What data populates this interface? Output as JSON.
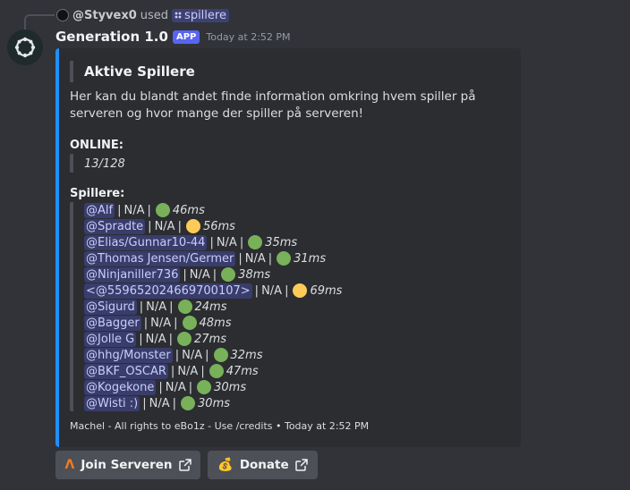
{
  "reply": {
    "user": "@Styvex0",
    "used_text": "used",
    "command": "spillere"
  },
  "message": {
    "bot_name": "Generation 1.0",
    "badge": "APP",
    "timestamp": "Today at 2:52 PM"
  },
  "embed": {
    "accent_color": "#1e90ff",
    "title": "Aktive Spillere",
    "description": "Her kan du blandt andet finde information omkring hvem spiller på serveren og hvor mange der spiller på serveren!",
    "online_label": "ONLINE:",
    "online_value": "13/128",
    "players_label": "Spillere:",
    "players": [
      {
        "name": "@Alf",
        "info": "N/A",
        "status": "green",
        "ping": "46ms"
      },
      {
        "name": "@Spradte",
        "info": "N/A",
        "status": "yellow",
        "ping": "56ms"
      },
      {
        "name": "@Elias/Gunnar10-44",
        "info": "N/A",
        "status": "green",
        "ping": "35ms"
      },
      {
        "name": "@Thomas Jensen/Germer",
        "info": "N/A",
        "status": "green",
        "ping": "31ms"
      },
      {
        "name": "@Ninjaniller736",
        "info": "N/A",
        "status": "green",
        "ping": "38ms"
      },
      {
        "name": "<@559652024669700107>",
        "info": "N/A",
        "status": "yellow",
        "ping": "69ms"
      },
      {
        "name": "@Sigurd",
        "info": "N/A",
        "status": "green",
        "ping": "24ms"
      },
      {
        "name": "@Bagger",
        "info": "N/A",
        "status": "green",
        "ping": "48ms"
      },
      {
        "name": "@Jolle G",
        "info": "N/A",
        "status": "green",
        "ping": "27ms"
      },
      {
        "name": "@hhg/Monster",
        "info": "N/A",
        "status": "green",
        "ping": "32ms"
      },
      {
        "name": "@BKF_OSCAR",
        "info": "N/A",
        "status": "green",
        "ping": "47ms"
      },
      {
        "name": "@Kogekone",
        "info": "N/A",
        "status": "green",
        "ping": "30ms"
      },
      {
        "name": "@Wisti :)",
        "info": "N/A",
        "status": "green",
        "ping": "30ms"
      }
    ],
    "footer": "Machel - All rights to eBo1z - Use /credits • Today at 2:52 PM"
  },
  "status_colors": {
    "green": "#78b159",
    "yellow": "#fdcb58"
  },
  "buttons": [
    {
      "label": "Join Serveren",
      "emoji": "ᐱ",
      "emoji_color": "#f47b20",
      "icon": "external-link-icon"
    },
    {
      "label": "Donate",
      "emoji": "💰",
      "icon": "external-link-icon"
    }
  ]
}
